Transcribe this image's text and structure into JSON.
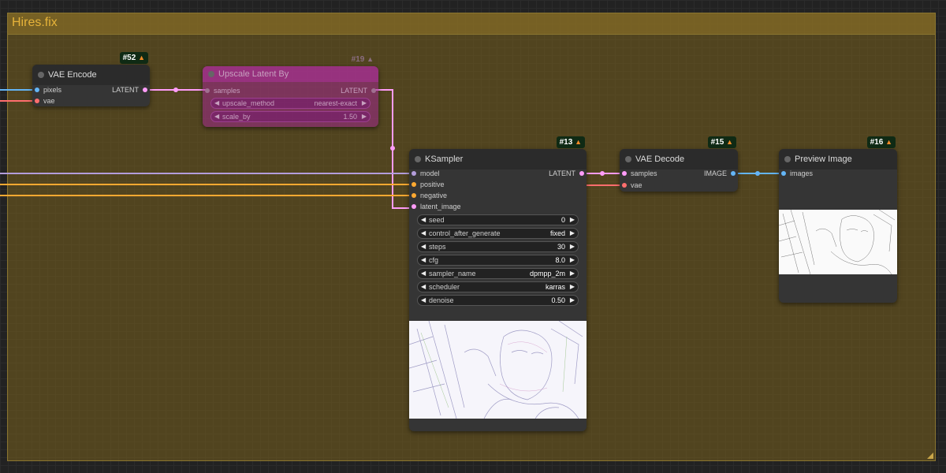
{
  "group": {
    "title": "Hires.fix"
  },
  "badge_icon": "fox-icon",
  "nodes": {
    "vae_encode": {
      "id": "#52",
      "title": "VAE Encode",
      "inputs": [
        "pixels",
        "vae"
      ],
      "output": "LATENT"
    },
    "upscale": {
      "id": "#19",
      "title": "Upscale Latent By",
      "input": "samples",
      "output": "LATENT",
      "widgets": [
        {
          "name": "upscale_method",
          "value": "nearest-exact"
        },
        {
          "name": "scale_by",
          "value": "1.50"
        }
      ]
    },
    "ksampler": {
      "id": "#13",
      "title": "KSampler",
      "inputs": [
        "model",
        "positive",
        "negative",
        "latent_image"
      ],
      "output": "LATENT",
      "widgets": [
        {
          "name": "seed",
          "value": "0"
        },
        {
          "name": "control_after_generate",
          "value": "fixed"
        },
        {
          "name": "steps",
          "value": "30"
        },
        {
          "name": "cfg",
          "value": "8.0"
        },
        {
          "name": "sampler_name",
          "value": "dpmpp_2m"
        },
        {
          "name": "scheduler",
          "value": "karras"
        },
        {
          "name": "denoise",
          "value": "0.50"
        }
      ]
    },
    "vae_decode": {
      "id": "#15",
      "title": "VAE Decode",
      "inputs": [
        "samples",
        "vae"
      ],
      "output": "IMAGE"
    },
    "preview": {
      "id": "#16",
      "title": "Preview Image",
      "input": "images"
    }
  },
  "colors": {
    "latent": "#ff9cf9",
    "image": "#64b5f6",
    "vae": "#ff6e6e",
    "model": "#b39ddb",
    "conditioning": "#ffa931"
  }
}
